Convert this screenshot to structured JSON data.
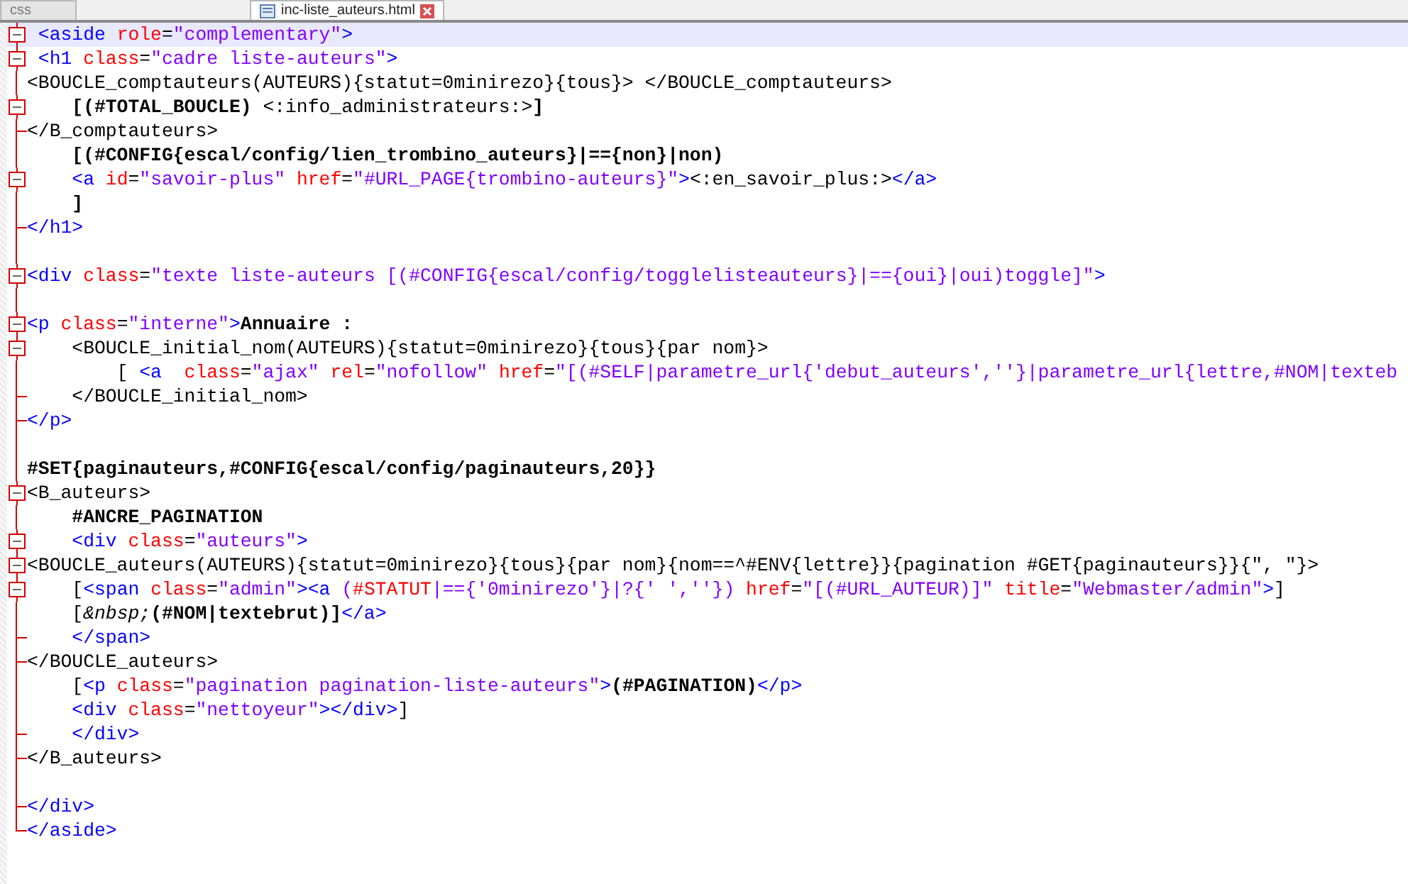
{
  "tabs": [
    {
      "label": "css",
      "selected": false
    },
    {
      "label": "inc-liste_auteurs.html",
      "selected": true
    }
  ],
  "editor": {
    "lines": [
      {
        "kind": "open",
        "current": true,
        "tokens": [
          {
            "kind": "tag",
            "text": " <aside "
          },
          {
            "kind": "attr",
            "text": "role"
          },
          {
            "kind": "text",
            "text": "="
          },
          {
            "kind": "val",
            "text": "\"complementary\""
          },
          {
            "kind": "tag",
            "text": ">"
          }
        ]
      },
      {
        "kind": "open",
        "current": false,
        "tokens": [
          {
            "kind": "tag",
            "text": " <h1 "
          },
          {
            "kind": "attr",
            "text": "class"
          },
          {
            "kind": "text",
            "text": "="
          },
          {
            "kind": "val",
            "text": "\"cadre liste-auteurs\""
          },
          {
            "kind": "tag",
            "text": ">"
          }
        ]
      },
      {
        "kind": "line",
        "current": false,
        "tokens": [
          {
            "kind": "text",
            "text": "<BOUCLE_comptauteurs(AUTEURS){statut=0minirezo}{tous}> </BOUCLE_comptauteurs>"
          }
        ]
      },
      {
        "kind": "open",
        "current": false,
        "tokens": [
          {
            "kind": "bold",
            "text": "    [(#TOTAL_BOUCLE)"
          },
          {
            "kind": "text",
            "text": " <:info_administrateurs:>"
          },
          {
            "kind": "bold",
            "text": "]"
          }
        ]
      },
      {
        "kind": "end",
        "current": false,
        "tokens": [
          {
            "kind": "text",
            "text": "</B_comptauteurs>"
          }
        ]
      },
      {
        "kind": "line",
        "current": false,
        "tokens": [
          {
            "kind": "bold",
            "text": "    [(#CONFIG{escal/config/lien_trombino_auteurs}|=={non}|non)"
          }
        ]
      },
      {
        "kind": "open",
        "current": false,
        "tokens": [
          {
            "kind": "tag",
            "text": "    <a "
          },
          {
            "kind": "attr",
            "text": "id"
          },
          {
            "kind": "text",
            "text": "="
          },
          {
            "kind": "val",
            "text": "\"savoir-plus\" "
          },
          {
            "kind": "attr",
            "text": "href"
          },
          {
            "kind": "text",
            "text": "="
          },
          {
            "kind": "val",
            "text": "\"#URL_PAGE{trombino-auteurs}\""
          },
          {
            "kind": "tag",
            "text": ">"
          },
          {
            "kind": "text",
            "text": "<:en_savoir_plus:>"
          },
          {
            "kind": "tag",
            "text": "</a>"
          }
        ]
      },
      {
        "kind": "line",
        "current": false,
        "tokens": [
          {
            "kind": "bold",
            "text": "    ]"
          }
        ]
      },
      {
        "kind": "end",
        "current": false,
        "tokens": [
          {
            "kind": "tag",
            "text": "</h1>"
          }
        ]
      },
      {
        "kind": "line",
        "current": false
      },
      {
        "kind": "open",
        "current": false,
        "tokens": [
          {
            "kind": "tag",
            "text": "<div "
          },
          {
            "kind": "attr",
            "text": "class"
          },
          {
            "kind": "text",
            "text": "="
          },
          {
            "kind": "val",
            "text": "\"texte liste-auteurs [(#CONFIG{escal/config/togglelisteauteurs}|=={oui}|oui)toggle]\""
          },
          {
            "kind": "tag",
            "text": ">"
          }
        ]
      },
      {
        "kind": "line",
        "current": false
      },
      {
        "kind": "open",
        "current": false,
        "tokens": [
          {
            "kind": "tag",
            "text": "<p "
          },
          {
            "kind": "attr",
            "text": "class"
          },
          {
            "kind": "text",
            "text": "="
          },
          {
            "kind": "val",
            "text": "\"interne\""
          },
          {
            "kind": "tag",
            "text": ">"
          },
          {
            "kind": "bold",
            "text": "Annuaire :"
          }
        ]
      },
      {
        "kind": "open",
        "current": false,
        "tokens": [
          {
            "kind": "text",
            "text": "    <BOUCLE_initial_nom(AUTEURS){statut=0minirezo}{tous}{par nom}>"
          }
        ]
      },
      {
        "kind": "line",
        "current": false,
        "tokens": [
          {
            "kind": "text",
            "text": "        [ "
          },
          {
            "kind": "tag",
            "text": "<a  "
          },
          {
            "kind": "attr",
            "text": "class"
          },
          {
            "kind": "text",
            "text": "="
          },
          {
            "kind": "val",
            "text": "\"ajax\" "
          },
          {
            "kind": "attr",
            "text": "rel"
          },
          {
            "kind": "text",
            "text": "="
          },
          {
            "kind": "val",
            "text": "\"nofollow\" "
          },
          {
            "kind": "attr",
            "text": "href"
          },
          {
            "kind": "text",
            "text": "="
          },
          {
            "kind": "val",
            "text": "\"[(#SELF|parametre_url{'debut_auteurs',''}|parametre_url{lettre,#NOM|texteb"
          }
        ]
      },
      {
        "kind": "end",
        "current": false,
        "tokens": [
          {
            "kind": "text",
            "text": "    </BOUCLE_initial_nom>"
          }
        ]
      },
      {
        "kind": "end",
        "current": false,
        "tokens": [
          {
            "kind": "tag",
            "text": "</p>"
          }
        ]
      },
      {
        "kind": "line",
        "current": false
      },
      {
        "kind": "line",
        "current": false,
        "tokens": [
          {
            "kind": "bold",
            "text": "#SET{paginauteurs,#CONFIG{escal/config/paginauteurs,20}}"
          }
        ]
      },
      {
        "kind": "open",
        "current": false,
        "tokens": [
          {
            "kind": "text",
            "text": "<B_auteurs>"
          }
        ]
      },
      {
        "kind": "line",
        "current": false,
        "tokens": [
          {
            "kind": "bold",
            "text": "    #ANCRE_PAGINATION"
          }
        ]
      },
      {
        "kind": "open",
        "current": false,
        "tokens": [
          {
            "kind": "tag",
            "text": "    <div "
          },
          {
            "kind": "attr",
            "text": "class"
          },
          {
            "kind": "text",
            "text": "="
          },
          {
            "kind": "val",
            "text": "\"auteurs\""
          },
          {
            "kind": "tag",
            "text": ">"
          }
        ]
      },
      {
        "kind": "open",
        "current": false,
        "tokens": [
          {
            "kind": "text",
            "text": "<BOUCLE_auteurs(AUTEURS){statut=0minirezo}{tous}{par nom}{nom==^#ENV{lettre}}{pagination #GET{paginauteurs}}{\", \"}>"
          }
        ]
      },
      {
        "kind": "open",
        "current": false,
        "tokens": [
          {
            "kind": "text",
            "text": "    ["
          },
          {
            "kind": "tag",
            "text": "<span "
          },
          {
            "kind": "attr",
            "text": "class"
          },
          {
            "kind": "text",
            "text": "="
          },
          {
            "kind": "val",
            "text": "\"admin\""
          },
          {
            "kind": "tag",
            "text": "><a "
          },
          {
            "kind": "val",
            "text": "("
          },
          {
            "kind": "attr",
            "text": "#STATUT"
          },
          {
            "kind": "val",
            "text": "|=={'0minirezo'}|?{' ',''}) "
          },
          {
            "kind": "attr",
            "text": "href"
          },
          {
            "kind": "text",
            "text": "="
          },
          {
            "kind": "val",
            "text": "\"[(#URL_AUTEUR)]\" "
          },
          {
            "kind": "attr",
            "text": "title"
          },
          {
            "kind": "text",
            "text": "="
          },
          {
            "kind": "val",
            "text": "\"Webmaster/admin\""
          },
          {
            "kind": "tag",
            "text": ">"
          },
          {
            "kind": "text",
            "text": "]"
          }
        ]
      },
      {
        "kind": "line",
        "current": false,
        "tokens": [
          {
            "kind": "text",
            "text": "    ["
          },
          {
            "kind": "ent",
            "text": "&nbsp;"
          },
          {
            "kind": "bold",
            "text": "(#NOM|textebrut)]"
          },
          {
            "kind": "tag",
            "text": "</a>"
          }
        ]
      },
      {
        "kind": "end",
        "current": false,
        "tokens": [
          {
            "kind": "tag",
            "text": "    </span>"
          }
        ]
      },
      {
        "kind": "end",
        "current": false,
        "tokens": [
          {
            "kind": "text",
            "text": "</BOUCLE_auteurs>"
          }
        ]
      },
      {
        "kind": "line",
        "current": false,
        "tokens": [
          {
            "kind": "text",
            "text": "    ["
          },
          {
            "kind": "tag",
            "text": "<p "
          },
          {
            "kind": "attr",
            "text": "class"
          },
          {
            "kind": "text",
            "text": "="
          },
          {
            "kind": "val",
            "text": "\"pagination pagination-liste-auteurs\""
          },
          {
            "kind": "tag",
            "text": ">"
          },
          {
            "kind": "bold",
            "text": "(#PAGINATION)"
          },
          {
            "kind": "tag",
            "text": "</p>"
          }
        ]
      },
      {
        "kind": "line",
        "current": false,
        "tokens": [
          {
            "kind": "tag",
            "text": "    <div "
          },
          {
            "kind": "attr",
            "text": "class"
          },
          {
            "kind": "text",
            "text": "="
          },
          {
            "kind": "val",
            "text": "\"nettoyeur\""
          },
          {
            "kind": "tag",
            "text": "></div>"
          },
          {
            "kind": "text",
            "text": "]"
          }
        ]
      },
      {
        "kind": "end",
        "current": false,
        "tokens": [
          {
            "kind": "tag",
            "text": "    </div>"
          }
        ]
      },
      {
        "kind": "end",
        "current": false,
        "tokens": [
          {
            "kind": "text",
            "text": "</B_auteurs>"
          }
        ]
      },
      {
        "kind": "line",
        "current": false
      },
      {
        "kind": "end",
        "current": false,
        "tokens": [
          {
            "kind": "tag",
            "text": "</div>"
          }
        ]
      },
      {
        "kind": "last",
        "current": false,
        "tokens": [
          {
            "kind": "tag",
            "text": "</aside>"
          }
        ]
      }
    ]
  }
}
